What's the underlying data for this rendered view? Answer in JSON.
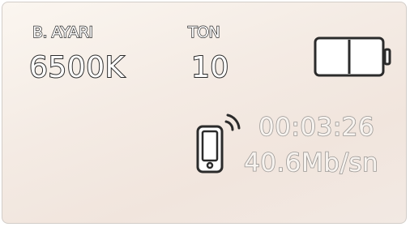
{
  "white_balance": {
    "label": "B. AYARI",
    "value": "6500K"
  },
  "tint": {
    "label": "TON",
    "value": "10"
  },
  "battery": {
    "icon": "battery-icon",
    "level": 0.5
  },
  "stream": {
    "icon": "phone-signal-icon",
    "timecode": "00:03:26",
    "bitrate": "40.6Mb/sn"
  },
  "colors": {
    "outline": "#2b2b2b",
    "dim_outline": "#9a9794",
    "background": "#f4ebe4"
  }
}
